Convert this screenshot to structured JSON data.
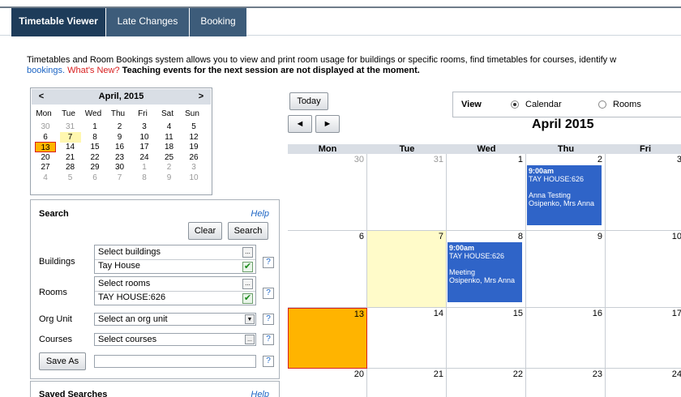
{
  "tabs": [
    {
      "label": "Timetable Viewer"
    },
    {
      "label": "Late Changes"
    },
    {
      "label": "Booking"
    }
  ],
  "intro": {
    "line1": "Timetables and Room Bookings system allows you to view and print room usage for buildings or specific rooms, find timetables for courses, identify w",
    "line2_link": "bookings.",
    "line2_whatsnew": "What's New?",
    "line2_bold": "Teaching events for the next session are not displayed at the moment."
  },
  "mini_calendar": {
    "prev": "<",
    "next": ">",
    "title": "April, 2015",
    "day_names": [
      "Mon",
      "Tue",
      "Wed",
      "Thu",
      "Fri",
      "Sat",
      "Sun"
    ],
    "weeks": [
      [
        "30",
        "31",
        "1",
        "2",
        "3",
        "4",
        "5"
      ],
      [
        "6",
        "7",
        "8",
        "9",
        "10",
        "11",
        "12"
      ],
      [
        "13",
        "14",
        "15",
        "16",
        "17",
        "18",
        "19"
      ],
      [
        "20",
        "21",
        "22",
        "23",
        "24",
        "25",
        "26"
      ],
      [
        "27",
        "28",
        "29",
        "30",
        "1",
        "2",
        "3"
      ],
      [
        "4",
        "5",
        "6",
        "7",
        "8",
        "9",
        "10"
      ]
    ]
  },
  "search": {
    "title": "Search",
    "help": "Help",
    "clear": "Clear",
    "search": "Search",
    "buildings_label": "Buildings",
    "buildings_placeholder": "Select buildings",
    "buildings_value": "Tay House",
    "rooms_label": "Rooms",
    "rooms_placeholder": "Select rooms",
    "rooms_value": "TAY HOUSE:626",
    "org_label": "Org Unit",
    "org_value": "Select an org unit",
    "courses_label": "Courses",
    "courses_value": "Select courses",
    "save_as": "Save As",
    "save_value": "",
    "question": "?",
    "more": "..."
  },
  "saved": {
    "title": "Saved Searches",
    "help": "Help"
  },
  "main": {
    "today": "Today",
    "prev": "◄",
    "next": "►",
    "view_label": "View",
    "calendar": "Calendar",
    "rooms": "Rooms",
    "month_title": "April 2015",
    "headers": [
      "Mon",
      "Tue",
      "Wed",
      "Thu",
      "Fri"
    ],
    "weeks": [
      [
        "30",
        "31",
        "1",
        "2",
        "3"
      ],
      [
        "6",
        "7",
        "8",
        "9",
        "10"
      ],
      [
        "13",
        "14",
        "15",
        "16",
        "17"
      ],
      [
        "20",
        "21",
        "22",
        "23",
        "24"
      ]
    ],
    "events": [
      {
        "time": "9:00am",
        "room": "TAY HOUSE:626",
        "title": "Anna Testing",
        "person": "Osipenko, Mrs Anna"
      },
      {
        "time": "9:00am",
        "room": "TAY HOUSE:626",
        "title": "Meeting",
        "person": "Osipenko, Mrs Anna"
      }
    ]
  },
  "colors": {
    "tab_bg": "#3d5c7a",
    "tab_active": "#1e3c5a",
    "event": "#2f64c8",
    "selected": "#ffb400",
    "today": "#fffbc9"
  }
}
